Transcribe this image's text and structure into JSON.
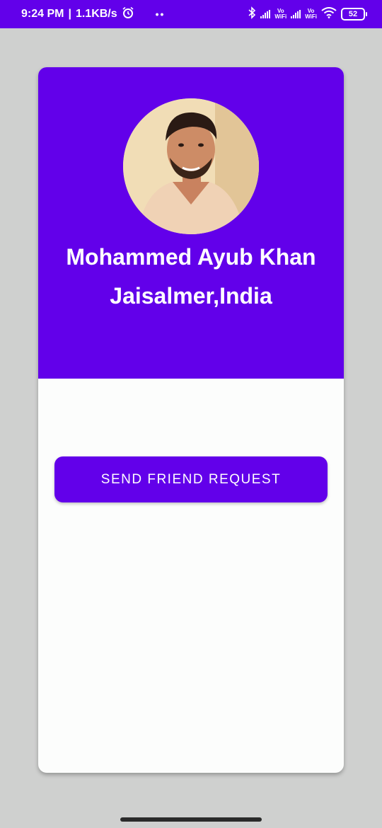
{
  "status_bar": {
    "time": "9:24 PM",
    "separator": "|",
    "net_speed": "1.1KB/s",
    "dots": "••",
    "vo_label": "Vo",
    "wifi_label": "WiFi",
    "battery_level": "52",
    "icons": [
      "alarm-icon",
      "bluetooth-icon",
      "signal-icon",
      "wifi-icon",
      "battery-icon"
    ]
  },
  "profile": {
    "name": "Mohammed Ayub Khan",
    "location": "Jaisalmer,India"
  },
  "actions": {
    "send_request_label": "SEND FRIEND REQUEST"
  },
  "colors": {
    "accent": "#6200ea",
    "background": "#cfd0cf",
    "card": "#fcfdfc"
  }
}
